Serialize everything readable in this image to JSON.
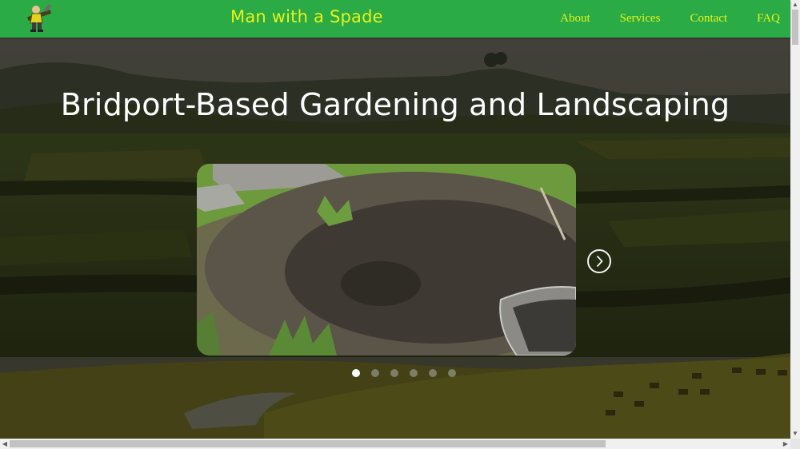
{
  "header": {
    "logo_icon": "gardener-with-spade-icon",
    "title": "Man with a Spade",
    "nav": [
      {
        "label": "About"
      },
      {
        "label": "Services"
      },
      {
        "label": "Contact"
      },
      {
        "label": "FAQ"
      }
    ]
  },
  "hero": {
    "heading": "Bridport-Based Gardening and Landscaping",
    "background": "dorset-countryside-photo",
    "carousel": {
      "current_slide": 1,
      "total_slides": 6,
      "slide_image": "dug-pond-hole-with-wheelbarrow-photo",
      "next_icon": "chevron-right-circle-icon"
    }
  },
  "colors": {
    "header_bg": "#2bab45",
    "title_color": "#e6f21b",
    "heading_color": "#ffffff"
  },
  "scrollbars": {
    "up_icon": "arrow-up-icon",
    "down_icon": "arrow-down-icon",
    "left_icon": "arrow-left-icon",
    "right_icon": "arrow-right-icon"
  }
}
